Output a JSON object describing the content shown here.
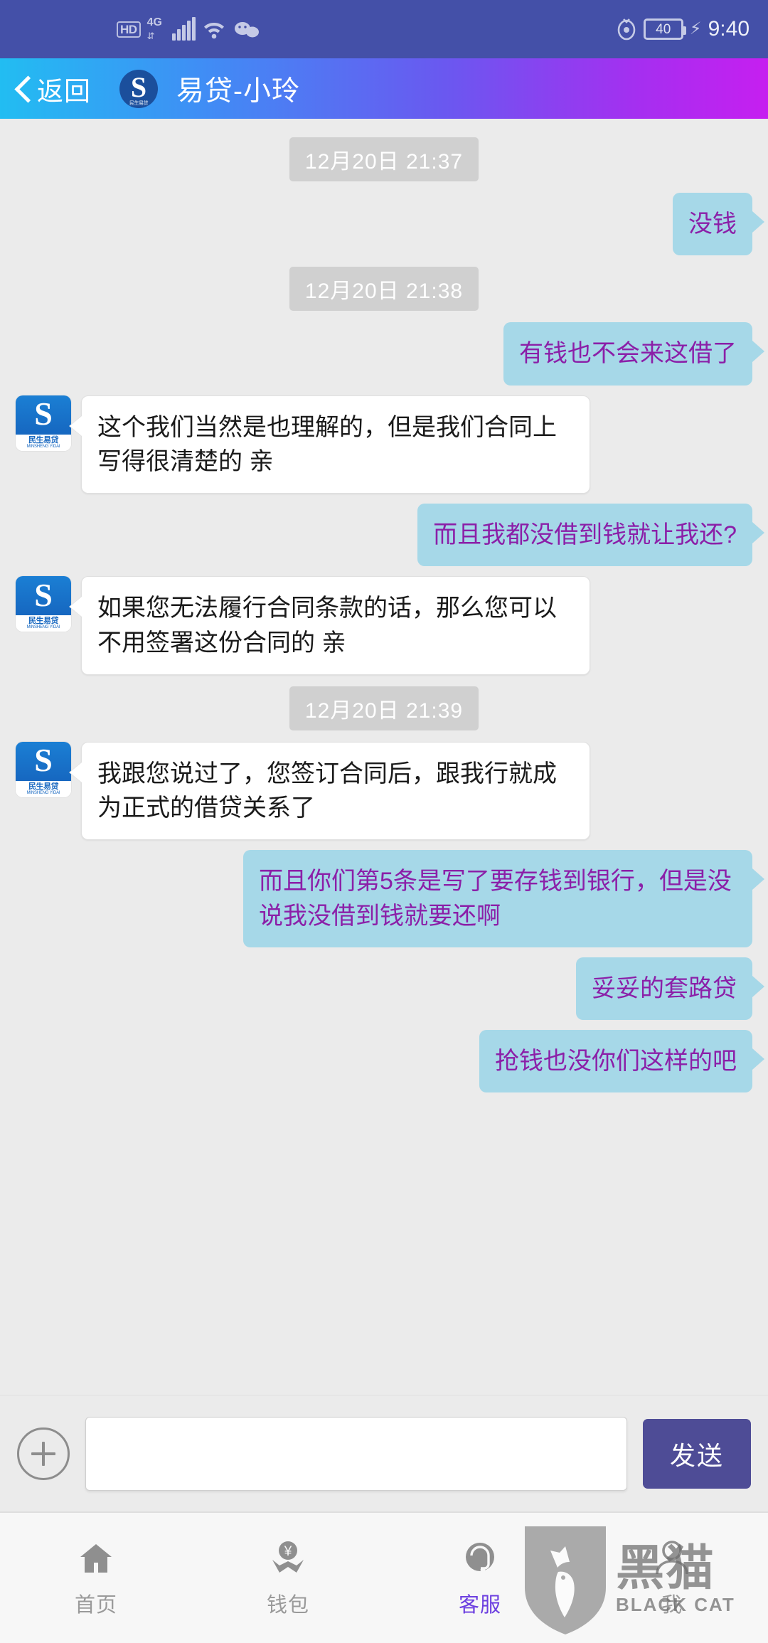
{
  "status_bar": {
    "hd_label": "HD",
    "network_label": "4G",
    "battery_level": "40",
    "time": "9:40",
    "icons": [
      "hd-icon",
      "4g-signal-icon",
      "signal-bars-icon",
      "wifi-icon",
      "wechat-icon",
      "eye-icon",
      "battery-icon",
      "charging-bolt-icon"
    ]
  },
  "header": {
    "back_label": "返回",
    "title": "易贷-小玲",
    "avatar_glyph": "S",
    "avatar_caption": "民生易贷"
  },
  "chat": {
    "avatar": {
      "glyph": "S",
      "name_cn": "民生易贷",
      "name_en": "MINSHENG YIDAI"
    },
    "messages": [
      {
        "type": "timestamp",
        "text": "12月20日 21:37"
      },
      {
        "type": "user",
        "text": "没钱"
      },
      {
        "type": "timestamp",
        "text": "12月20日 21:38"
      },
      {
        "type": "user",
        "text": "有钱也不会来这借了"
      },
      {
        "type": "agent",
        "text": "这个我们当然是也理解的，但是我们合同上写得很清楚的 亲"
      },
      {
        "type": "user",
        "text": "而且我都没借到钱就让我还?"
      },
      {
        "type": "agent",
        "text": "如果您无法履行合同条款的话，那么您可以不用签署这份合同的 亲"
      },
      {
        "type": "timestamp",
        "text": "12月20日 21:39"
      },
      {
        "type": "agent",
        "text": "我跟您说过了，您签订合同后，跟我行就成为正式的借贷关系了"
      },
      {
        "type": "user",
        "text": "而且你们第5条是写了要存钱到银行，但是没说我没借到钱就要还啊"
      },
      {
        "type": "user",
        "text": "妥妥的套路贷"
      },
      {
        "type": "user",
        "text": "抢钱也没你们这样的吧"
      }
    ]
  },
  "input_bar": {
    "add_icon": "plus-icon",
    "message_value": "",
    "message_placeholder": "",
    "send_label": "发送"
  },
  "bottom_nav": {
    "items": [
      {
        "label": "首页",
        "icon": "home-icon",
        "active": false
      },
      {
        "label": "钱包",
        "icon": "wallet-yuan-icon",
        "active": false
      },
      {
        "label": "客服",
        "icon": "headset-support-icon",
        "active": true
      },
      {
        "label": "我",
        "icon": "person-icon",
        "active": false
      }
    ]
  },
  "watermark": {
    "text_cn": "黑猫",
    "text_en": "BLACK CAT"
  },
  "colors": {
    "status_bar": "#4450a8",
    "header_gradient_start": "#22bdf2",
    "header_gradient_end": "#c61ff0",
    "user_bubble": "#a6d8e8",
    "user_text": "#8b1fa8",
    "agent_bubble": "#ffffff",
    "send_button": "#4e4c96",
    "active_nav": "#6c3fe0"
  }
}
